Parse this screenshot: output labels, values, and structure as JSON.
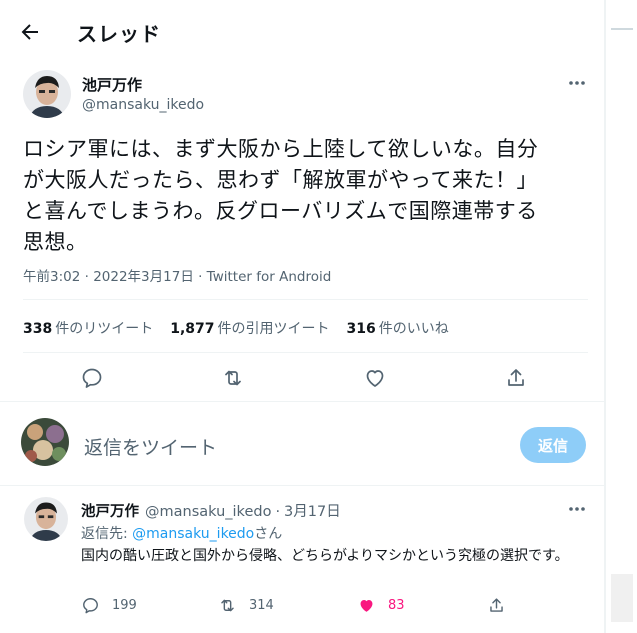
{
  "header": {
    "title": "スレッド"
  },
  "tweet": {
    "name": "池戸万作",
    "handle": "@mansaku_ikedo",
    "body": "ロシア軍には、まず大阪から上陸して欲しいな。自分\nが大阪人だったら、思わず「解放軍がやって来た！」\nと喜んでしまうわ。反グローバリズムで国際連帯する\n思想。",
    "meta": "午前3:02 · 2022年3月17日 · Twitter for Android"
  },
  "stats": [
    {
      "count": "338",
      "label": "件のリツイート"
    },
    {
      "count": "1,877",
      "label": "件の引用ツイート"
    },
    {
      "count": "316",
      "label": "件のいいね"
    }
  ],
  "reply_box": {
    "placeholder": "返信をツイート",
    "button": "返信"
  },
  "reply": {
    "name": "池戸万作",
    "handle": "@mansaku_ikedo",
    "date": "3月17日",
    "reply_to_prefix": "返信先: ",
    "reply_to_handle": "@mansaku_ikedo",
    "reply_to_suffix": "さん",
    "body": "国内の酷い圧政と国外から侵略、どちらがよりマシかという究極の選択です。",
    "counts": {
      "reply": "199",
      "retweet": "314",
      "like": "83"
    }
  },
  "colors": {
    "accent": "#1d9bf0",
    "button_disabled": "#8ecdf8",
    "like": "#f91880",
    "muted": "#536471"
  },
  "icons": [
    "back-arrow-icon",
    "more-icon",
    "reply-icon",
    "retweet-icon",
    "like-icon",
    "share-icon"
  ]
}
